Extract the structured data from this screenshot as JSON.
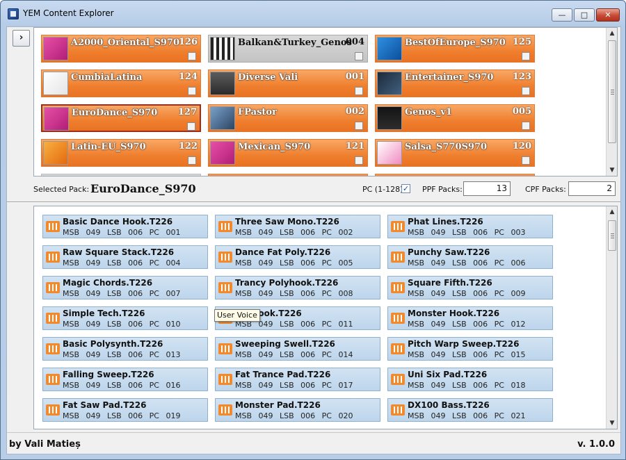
{
  "window": {
    "title": "YEM Content Explorer",
    "min": "—",
    "max": "□",
    "close": "✕"
  },
  "nav": {
    "icon": "chevron-right-icon",
    "glyph": "›"
  },
  "packs": [
    {
      "name": "A2000_Oriental_S970",
      "num": "126",
      "thumb": "t-pink",
      "style": "orange"
    },
    {
      "name": "Balkan&Turkey_Genos",
      "num": "004",
      "thumb": "t-bars",
      "style": "gray"
    },
    {
      "name": "BestOfEurope_S970",
      "num": "125",
      "thumb": "t-blue",
      "style": "orange"
    },
    {
      "name": "CumbiaLatina",
      "num": "124",
      "thumb": "t-white",
      "style": "orange"
    },
    {
      "name": "Diverse Vali",
      "num": "001",
      "thumb": "t-man",
      "style": "orange"
    },
    {
      "name": "Entertainer_S970",
      "num": "123",
      "thumb": "t-dark",
      "style": "orange"
    },
    {
      "name": "EuroDance_S970",
      "num": "127",
      "thumb": "t-pink",
      "style": "orange",
      "selected": true
    },
    {
      "name": "FPastor",
      "num": "002",
      "thumb": "t-photo",
      "style": "orange"
    },
    {
      "name": "Genos_v1",
      "num": "005",
      "thumb": "t-black",
      "style": "orange"
    },
    {
      "name": "Latin-EU_S970",
      "num": "122",
      "thumb": "t-orange",
      "style": "orange"
    },
    {
      "name": "Mexican_S970",
      "num": "121",
      "thumb": "t-pink",
      "style": "orange"
    },
    {
      "name": "Salsa_S770S970",
      "num": "120",
      "thumb": "t-salsa",
      "style": "orange"
    }
  ],
  "selection": {
    "label": "Selected Pack:",
    "name": "EuroDance_S970",
    "pc_label": "PC (1-128)",
    "pc_checked": "✓",
    "ppf_label": "PPF Packs:",
    "ppf_value": "13",
    "cpf_label": "CPF Packs:",
    "cpf_value": "2"
  },
  "voices": [
    {
      "name": "Basic Dance Hook.T226",
      "params": "MSB 049 LSB 006 PC 001"
    },
    {
      "name": "Three Saw Mono.T226",
      "params": "MSB 049 LSB 006 PC 002"
    },
    {
      "name": "Phat Lines.T226",
      "params": "MSB 049 LSB 006 PC 003"
    },
    {
      "name": "Raw Square Stack.T226",
      "params": "MSB 049 LSB 006 PC 004"
    },
    {
      "name": "Dance Fat Poly.T226",
      "params": "MSB 049 LSB 006 PC 005"
    },
    {
      "name": "Punchy Saw.T226",
      "params": "MSB 049 LSB 006 PC 006"
    },
    {
      "name": "Magic Chords.T226",
      "params": "MSB 049 LSB 006 PC 007"
    },
    {
      "name": "Trancy Polyhook.T226",
      "params": "MSB 049 LSB 006 PC 008"
    },
    {
      "name": "Square Fifth.T226",
      "params": "MSB 049 LSB 006 PC 009"
    },
    {
      "name": "Simple Tech.T226",
      "params": "MSB 049 LSB 006 PC 010"
    },
    {
      "name": "aw Hook.T226",
      "params": "MSB 049 LSB 006 PC 011"
    },
    {
      "name": "Monster Hook.T226",
      "params": "MSB 049 LSB 006 PC 012"
    },
    {
      "name": "Basic Polysynth.T226",
      "params": "MSB 049 LSB 006 PC 013"
    },
    {
      "name": "Sweeping Swell.T226",
      "params": "MSB 049 LSB 006 PC 014"
    },
    {
      "name": "Pitch Warp Sweep.T226",
      "params": "MSB 049 LSB 006 PC 015"
    },
    {
      "name": "Falling Sweep.T226",
      "params": "MSB 049 LSB 006 PC 016"
    },
    {
      "name": "Fat Trance Pad.T226",
      "params": "MSB 049 LSB 006 PC 017"
    },
    {
      "name": "Uni Six Pad.T226",
      "params": "MSB 049 LSB 006 PC 018"
    },
    {
      "name": "Fat Saw Pad.T226",
      "params": "MSB 049 LSB 006 PC 019"
    },
    {
      "name": "Monster Pad.T226",
      "params": "MSB 049 LSB 006 PC 020"
    },
    {
      "name": "DX100 Bass.T226",
      "params": "MSB 049 LSB 006 PC 021"
    }
  ],
  "tooltip": "User Voice",
  "footer": {
    "author": "by Vali Matieș",
    "version": "v. 1.0.0"
  },
  "colors": {
    "pack_orange": "#ef7f2e",
    "voice_blue": "#c7dcf0",
    "selected_border": "#9b2f1c",
    "icon_orange": "#f08a2c"
  }
}
